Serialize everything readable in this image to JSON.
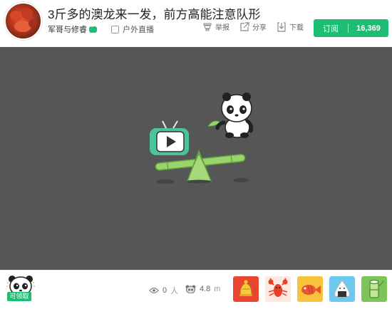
{
  "stream": {
    "title": "3斤多的澳龙来一发，前方高能注意队形",
    "anchor_name": "军哥与修睿",
    "category": "户外直播"
  },
  "actions": {
    "report_label": "举报",
    "share_label": "分享",
    "download_label": "下载"
  },
  "subscribe": {
    "label": "订阅",
    "count": "16,369"
  },
  "bottom": {
    "claim_label": "可领取",
    "viewers": "0",
    "viewers_unit": "人",
    "bamboo": "4.8",
    "bamboo_unit": "m"
  },
  "gifts": [
    {
      "icon": "golden-bell-gift-icon",
      "color": "#e8462f"
    },
    {
      "icon": "lobster-gift-icon",
      "color": "#ef5a3c"
    },
    {
      "icon": "fish-gift-icon",
      "color": "#f7c33c"
    },
    {
      "icon": "onigiri-gift-icon",
      "color": "#6ec9ef"
    },
    {
      "icon": "bamboo-gift-icon",
      "color": "#7cc45a"
    }
  ]
}
